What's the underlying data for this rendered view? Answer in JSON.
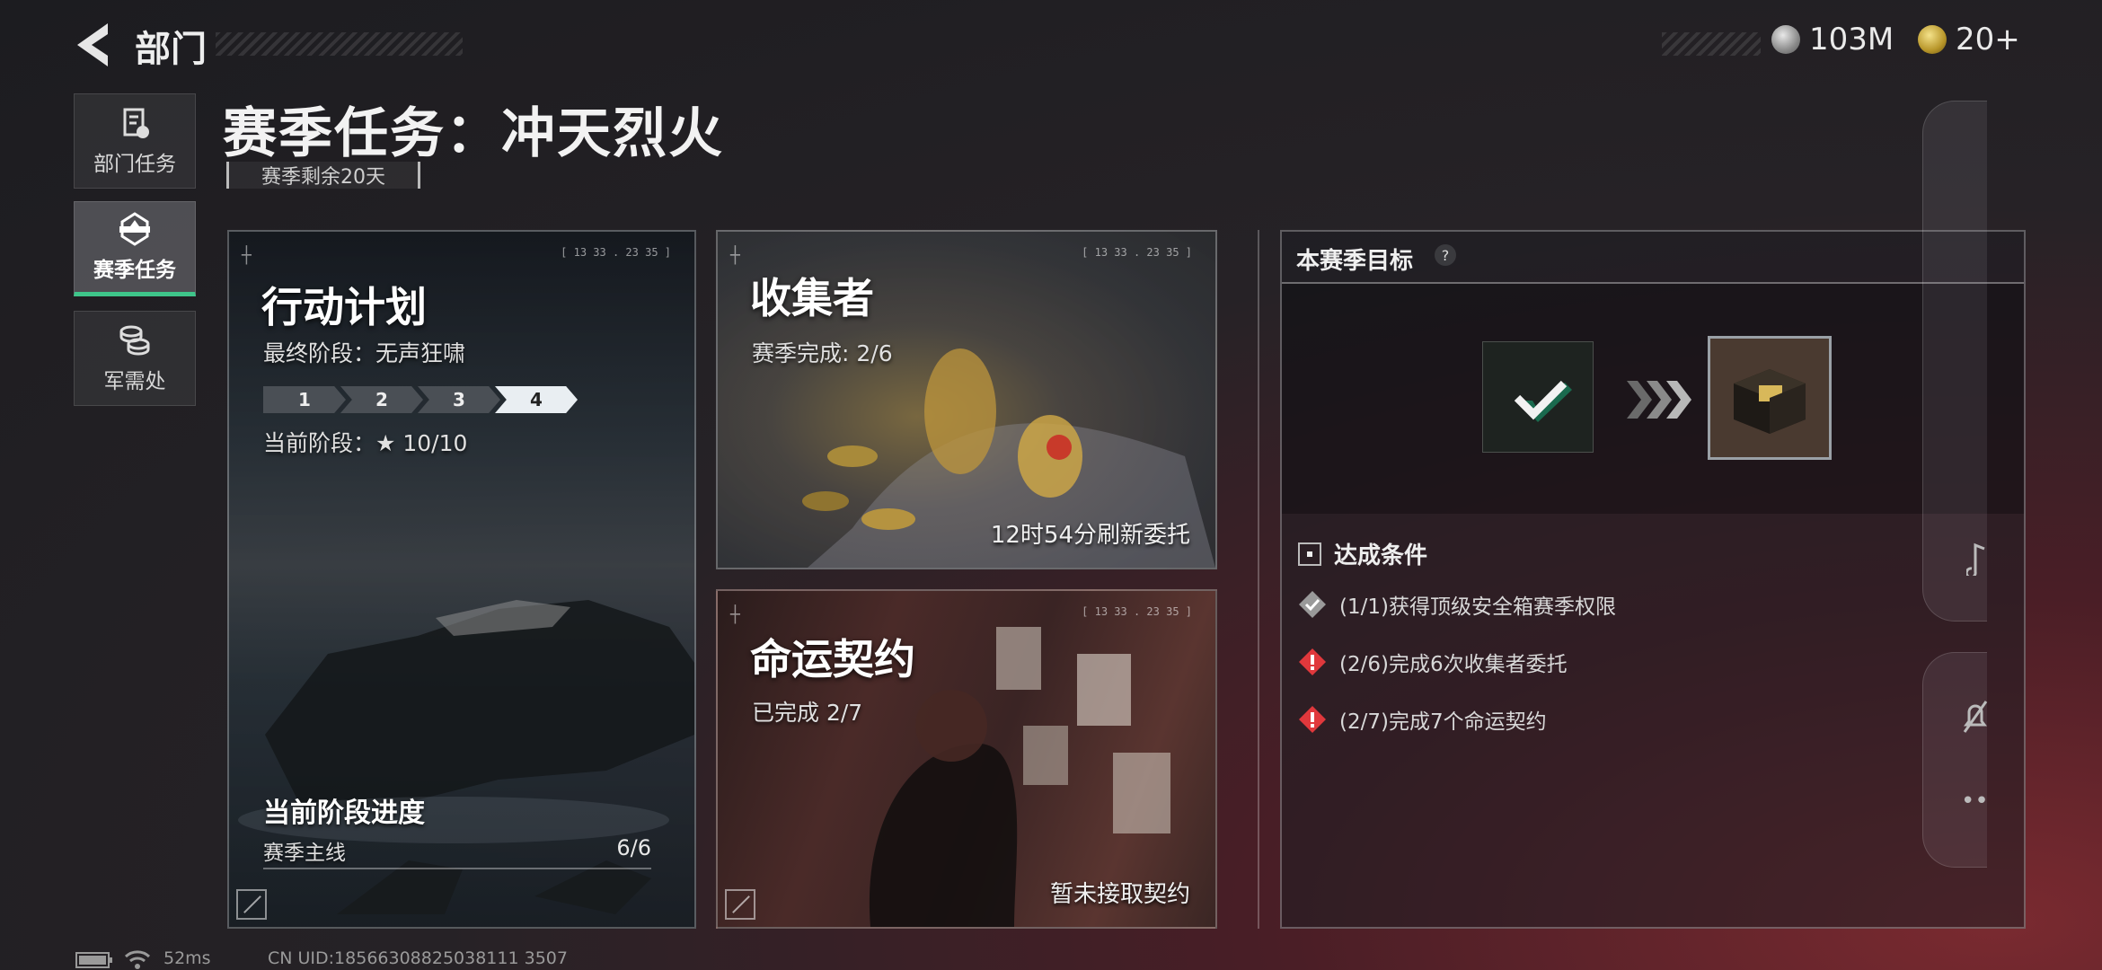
{
  "header": {
    "back_label": "部门",
    "currency_1": "103M",
    "currency_2": "20+"
  },
  "nav": [
    {
      "label": "部门任务"
    },
    {
      "label": "赛季任务"
    },
    {
      "label": "军需处"
    }
  ],
  "page": {
    "title": "赛季任务：冲天烈火",
    "season_remaining": "赛季剩余20天"
  },
  "card_plan": {
    "title": "行动计划",
    "final_stage": "最终阶段：无声狂啸",
    "stages": [
      "1",
      "2",
      "3",
      "4"
    ],
    "current_stage_label": "当前阶段：★ 10/10",
    "progress_title": "当前阶段进度",
    "progress_name": "赛季主线",
    "progress_value": "6/6"
  },
  "card_collector": {
    "title": "收集者",
    "sub": "赛季完成: 2/6",
    "refresh": "12时54分刷新委托"
  },
  "card_contract": {
    "title": "命运契约",
    "sub": "已完成 2/7",
    "status": "暂未接取契约"
  },
  "goal": {
    "title": "本赛季目标",
    "help": "?",
    "conditions_title": "达成条件",
    "conditions": [
      {
        "text": "(1/1)获得顶级安全箱赛季权限",
        "state": "done"
      },
      {
        "text": "(2/6)完成6次收集者委托",
        "state": "pending"
      },
      {
        "text": "(2/7)完成7个命运契约",
        "state": "pending"
      }
    ]
  },
  "statusbar": {
    "ping": "52ms",
    "uid": "CN UID:18566308825038111 3507"
  },
  "colors": {
    "accent_green": "#3ec58a",
    "warn_red": "#e0383c",
    "done_grey": "#bdbdbd"
  }
}
